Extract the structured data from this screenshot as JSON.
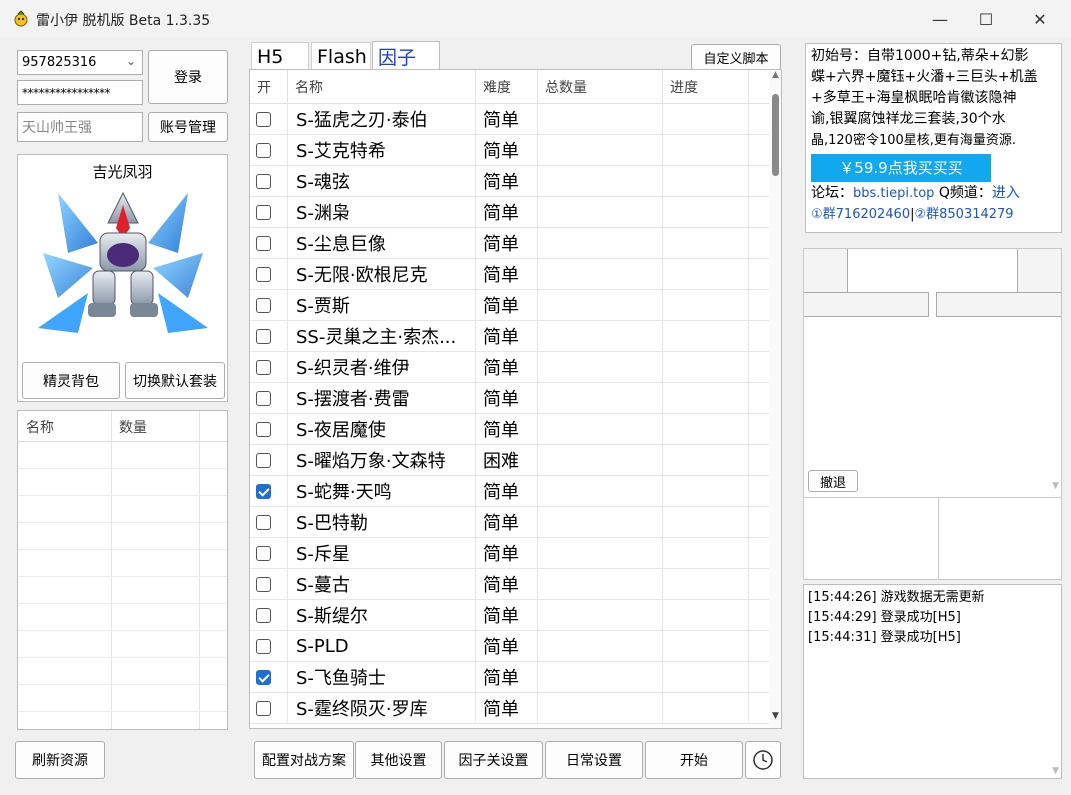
{
  "app": {
    "title": "雷小伊 脱机版 Beta 1.3.35"
  },
  "window": {
    "minimize": "—",
    "maximize": "☐",
    "close": "✕"
  },
  "login": {
    "account": "957825316",
    "password": "****************",
    "nickname_placeholder": "天山帅王强",
    "login_button": "登录",
    "account_manage_button": "账号管理"
  },
  "pet": {
    "name": "吉光凤羽",
    "bag_button": "精灵背包",
    "switch_button": "切换默认套装"
  },
  "inventory": {
    "columns": [
      "名称",
      "数量"
    ]
  },
  "refresh_button": "刷新资源",
  "tabs": [
    {
      "label": "H5"
    },
    {
      "label": "Flash"
    },
    {
      "label": "因子"
    }
  ],
  "custom_script_button": "自定义脚本",
  "table": {
    "columns": [
      "开",
      "名称",
      "难度",
      "总数量",
      "进度"
    ],
    "rows": [
      {
        "checked": false,
        "name": "S-猛虎之刃·泰伯",
        "difficulty": "简单"
      },
      {
        "checked": false,
        "name": "S-艾克特希",
        "difficulty": "简单"
      },
      {
        "checked": false,
        "name": "S-魂弦",
        "difficulty": "简单"
      },
      {
        "checked": false,
        "name": "S-渊枭",
        "difficulty": "简单"
      },
      {
        "checked": false,
        "name": "S-尘息巨像",
        "difficulty": "简单"
      },
      {
        "checked": false,
        "name": "S-无限·欧根尼克",
        "difficulty": "简单"
      },
      {
        "checked": false,
        "name": "S-贾斯",
        "difficulty": "简单"
      },
      {
        "checked": false,
        "name": "SS-灵巢之主·索杰...",
        "difficulty": "简单"
      },
      {
        "checked": false,
        "name": "S-织灵者·维伊",
        "difficulty": "简单"
      },
      {
        "checked": false,
        "name": "S-摆渡者·费雷",
        "difficulty": "简单"
      },
      {
        "checked": false,
        "name": "S-夜居魔使",
        "difficulty": "简单"
      },
      {
        "checked": false,
        "name": "S-曜焰万象·文森特",
        "difficulty": "困难"
      },
      {
        "checked": true,
        "name": "S-蛇舞·天鸣",
        "difficulty": "简单"
      },
      {
        "checked": false,
        "name": "S-巴特勒",
        "difficulty": "简单"
      },
      {
        "checked": false,
        "name": "S-斥星",
        "difficulty": "简单"
      },
      {
        "checked": false,
        "name": "S-蔓古",
        "difficulty": "简单"
      },
      {
        "checked": false,
        "name": "S-斯缇尔",
        "difficulty": "简单"
      },
      {
        "checked": false,
        "name": "S-PLD",
        "difficulty": "简单"
      },
      {
        "checked": true,
        "name": "S-飞鱼骑士",
        "difficulty": "简单"
      },
      {
        "checked": false,
        "name": "S-霆终陨灭·罗库",
        "difficulty": "简单"
      }
    ]
  },
  "bottom_buttons": {
    "battle_plan": "配置对战方案",
    "other_settings": "其他设置",
    "factor_settings": "因子关设置",
    "daily_settings": "日常设置",
    "start": "开始"
  },
  "ad": {
    "line1": "初始号：自带1000+钻,蒂朵+幻影",
    "line2": "蝶+六界+魔钰+火潘+三巨头+机盖",
    "line3": "+多草王+海皇枫眠哈肯徽该隐神",
    "line4": "谕,银翼腐蚀祥龙三套装,30个水",
    "line5": "晶,120密令100星核,更有海量资源.",
    "buy_button": "￥59.9点我买买买",
    "forum_label": "论坛：",
    "forum_url": "bbs.tiepi.top",
    "channel_label": " Q频道：",
    "channel_link": "进入",
    "group1": "①群716202460",
    "separator": "|",
    "group2": "②群850314279"
  },
  "retreat_button": "撤退",
  "log": [
    "[15:44:26] 游戏数据无需更新",
    "[15:44:29] 登录成功[H5]",
    "[15:44:31] 登录成功[H5]"
  ]
}
